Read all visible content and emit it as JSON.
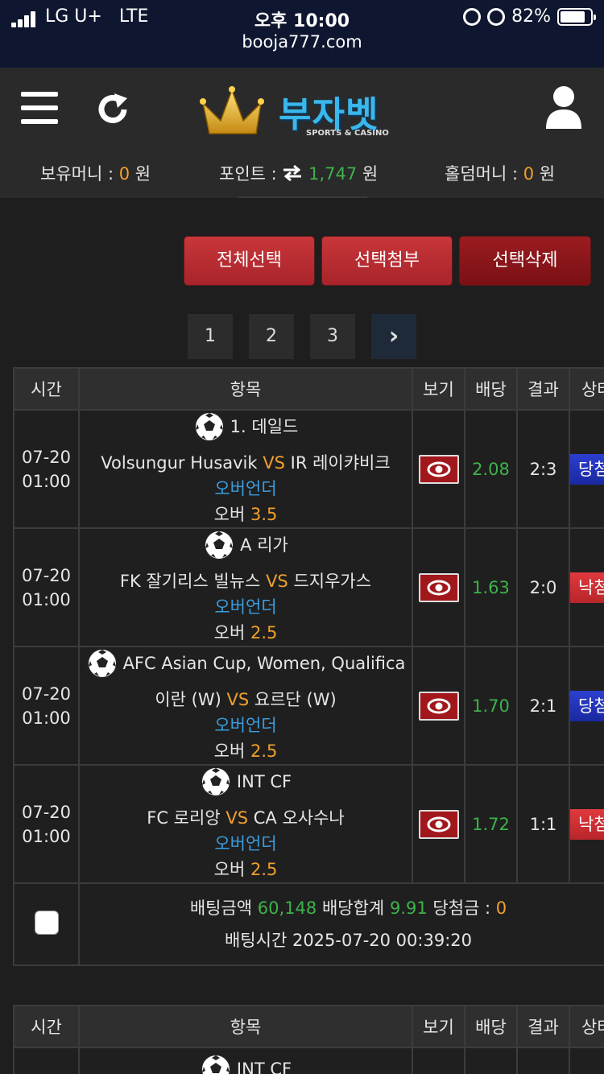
{
  "status_bar": {
    "carrier": "LG U+",
    "network": "LTE",
    "time": "오후 10:00",
    "battery": "82%",
    "url": "booja777.com"
  },
  "header": {
    "logo_text": "부자벳",
    "logo_subtext": "SPORTS & CASINO",
    "icons": [
      "menu-icon",
      "refresh-icon",
      "user-icon"
    ],
    "balances": {
      "money_label": "보유머니 :",
      "money_value": "0",
      "point_label": "포인트 :",
      "point_value": "1,747",
      "holdem_label": "홀덤머니 :",
      "holdem_value": "0",
      "unit": "원"
    }
  },
  "actions": {
    "select_all": "전체선택",
    "attach_selected": "선택첨부",
    "delete_selected": "선택삭제"
  },
  "pagination": {
    "pages": [
      "1",
      "2",
      "3"
    ],
    "next": "›"
  },
  "table": {
    "headers": [
      "시간",
      "항목",
      "보기",
      "배당",
      "결과",
      "상태"
    ],
    "rows": [
      {
        "date": "07-20",
        "time": "01:00",
        "league": "1. 데일드",
        "home": "Volsungur Husavik",
        "vs": "VS",
        "away": "IR 레이캬비크",
        "market": "오버언더",
        "pick": "오버",
        "line": "3.5",
        "odds": "2.08",
        "result": "2:3",
        "status": "당첨"
      },
      {
        "date": "07-20",
        "time": "01:00",
        "league": "A 리가",
        "home": "FK 잘기리스 빌뉴스",
        "vs": "VS",
        "away": "드지우가스",
        "market": "오버언더",
        "pick": "오버",
        "line": "2.5",
        "odds": "1.63",
        "result": "2:0",
        "status": "낙첨"
      },
      {
        "date": "07-20",
        "time": "01:00",
        "league": "AFC Asian Cup, Women, Qualifica",
        "home": "이란 (W)",
        "vs": "VS",
        "away": "요르단 (W)",
        "market": "오버언더",
        "pick": "오버",
        "line": "2.5",
        "odds": "1.70",
        "result": "2:1",
        "status": "당첨"
      },
      {
        "date": "07-20",
        "time": "01:00",
        "league": "INT CF",
        "home": "FC 로리앙",
        "vs": "VS",
        "away": "CA 오사수나",
        "market": "오버언더",
        "pick": "오버",
        "line": "2.5",
        "odds": "1.72",
        "result": "1:1",
        "status": "낙첨"
      }
    ],
    "summary": {
      "bet_amount_label": "배팅금액",
      "bet_amount": "60,148",
      "odds_total_label": "배당합계",
      "odds_total": "9.91",
      "win_label": "당첨금 :",
      "win_amount": "0",
      "bet_time_label": "배팅시간",
      "bet_time": "2025-07-20 00:39:20"
    }
  },
  "table2": {
    "headers": [
      "시간",
      "항목",
      "보기",
      "배당",
      "결과",
      "상태"
    ],
    "first_league": "INT CF"
  },
  "colors": {
    "accent_orange": "#f0a02c",
    "odds_green": "#3db34a",
    "market_blue": "#3a9de0",
    "win_blue": "#2c3fd0",
    "lose_red": "#e0393e"
  }
}
